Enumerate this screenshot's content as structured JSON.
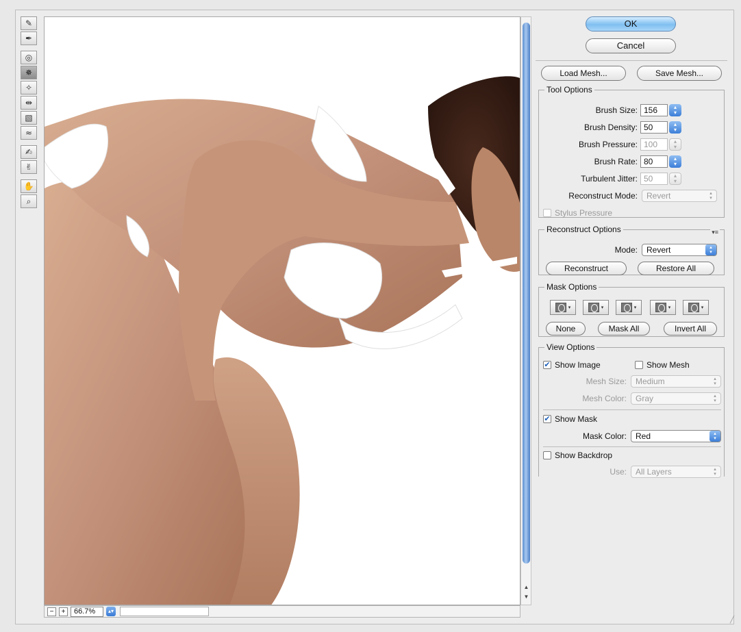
{
  "buttons": {
    "ok": "OK",
    "cancel": "Cancel",
    "load_mesh": "Load Mesh...",
    "save_mesh": "Save Mesh..."
  },
  "tools": [
    "forward-warp",
    "reconstruct",
    "twirl-clockwise",
    "pucker",
    "bloat",
    "push-left",
    "mirror",
    "turbulence",
    "freeze-mask",
    "thaw-mask",
    "hand",
    "zoom"
  ],
  "tool_options": {
    "legend": "Tool Options",
    "brush_size_label": "Brush Size:",
    "brush_size": "156",
    "brush_density_label": "Brush Density:",
    "brush_density": "50",
    "brush_pressure_label": "Brush Pressure:",
    "brush_pressure": "100",
    "brush_rate_label": "Brush Rate:",
    "brush_rate": "80",
    "turbulent_jitter_label": "Turbulent Jitter:",
    "turbulent_jitter": "50",
    "reconstruct_mode_label": "Reconstruct Mode:",
    "reconstruct_mode": "Revert",
    "stylus_pressure_label": "Stylus Pressure"
  },
  "reconstruct_options": {
    "legend": "Reconstruct Options",
    "mode_label": "Mode:",
    "mode": "Revert",
    "reconstruct": "Reconstruct",
    "restore_all": "Restore All"
  },
  "mask_options": {
    "legend": "Mask Options",
    "none": "None",
    "mask_all": "Mask All",
    "invert_all": "Invert All"
  },
  "view_options": {
    "legend": "View Options",
    "show_image": "Show Image",
    "show_image_checked": true,
    "show_mesh": "Show Mesh",
    "show_mesh_checked": false,
    "mesh_size_label": "Mesh Size:",
    "mesh_size": "Medium",
    "mesh_color_label": "Mesh Color:",
    "mesh_color": "Gray",
    "show_mask": "Show Mask",
    "show_mask_checked": true,
    "mask_color_label": "Mask Color:",
    "mask_color": "Red",
    "show_backdrop": "Show Backdrop",
    "show_backdrop_checked": false,
    "use_label": "Use:",
    "use": "All Layers"
  },
  "zoom": {
    "level": "66.7%"
  },
  "colors": {
    "accent": "#3c7ed8",
    "primary_button": "#7fbff1",
    "skin": "#c99a7c"
  }
}
